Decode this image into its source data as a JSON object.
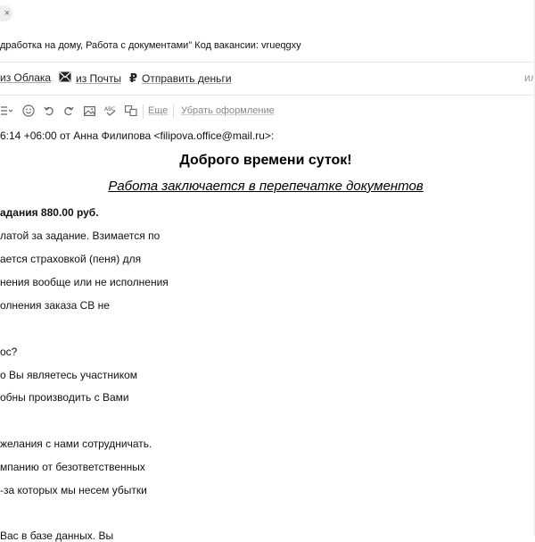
{
  "chip": {
    "close_symbol": "×"
  },
  "subject": {
    "text": "дработка на дому, Работа с документами\" Код вакансии: vrueqgxy"
  },
  "attach": {
    "cloud": "из Облака",
    "mail": "из Почты",
    "money": "Отправить деньги",
    "right_fragment": "ил"
  },
  "toolbar": {
    "more": "Еще",
    "remove_format": "Убрать оформление"
  },
  "quote_header": "6:14 +06:00 от Анна Филипова <filipova.office@mail.ru>:",
  "greeting": "Доброго времени суток!",
  "work_line": "Работа заключается в перепечатке документов",
  "body_lines": [
    "адания 880.00 руб.",
    "латой за задание. Взимается по",
    "ается страховкой (пеня) для",
    "нения вообще или не исполнения",
    "олнения заказа СВ не",
    "",
    "ос?",
    "о Вы являетесь участником",
    "обны производить с Вами",
    "",
    "желания с нами сотрудничать.",
    "мпанию от безответственных",
    "-за которых мы несем убытки",
    "",
    "Вас в базе данных. Вы"
  ]
}
